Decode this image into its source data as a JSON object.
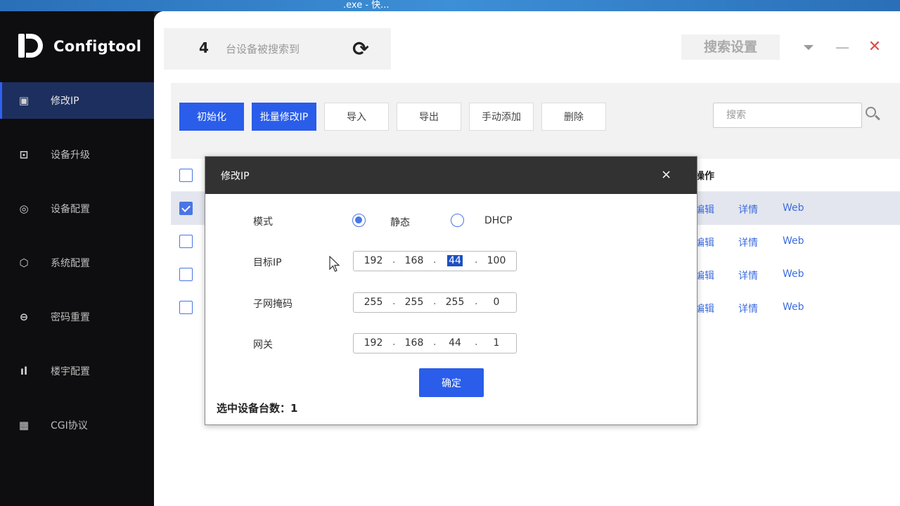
{
  "titlebar": {
    "text": ".exe - 快..."
  },
  "app": {
    "name": "Configtool"
  },
  "sidebar": {
    "items": [
      {
        "label": "修改IP",
        "icon": "ip-icon",
        "glyph": "▣"
      },
      {
        "label": "设备升级",
        "icon": "upgrade-icon",
        "glyph": "⊡"
      },
      {
        "label": "设备配置",
        "icon": "device-config-icon",
        "glyph": "◎"
      },
      {
        "label": "系统配置",
        "icon": "system-config-icon",
        "glyph": "⬡"
      },
      {
        "label": "密码重置",
        "icon": "password-reset-icon",
        "glyph": "⊖"
      },
      {
        "label": "楼宇配置",
        "icon": "building-config-icon",
        "glyph": "ıl"
      },
      {
        "label": "CGI协议",
        "icon": "cgi-icon",
        "glyph": "▦"
      }
    ]
  },
  "header": {
    "device_count": "4",
    "device_count_label": "台设备被搜索到",
    "search_settings": "搜索设置",
    "icons": {
      "refresh": "refresh-icon",
      "menu": "dropdown-icon",
      "minimize": "minimize-icon",
      "close": "close-icon"
    },
    "glyphs": {
      "refresh": "⟳",
      "menu": "⏷",
      "minimize": "—",
      "close": "✕"
    }
  },
  "toolbar": {
    "init": "初始化",
    "batch_modify": "批量修改IP",
    "import": "导入",
    "export": "导出",
    "manual_add": "手动添加",
    "delete": "删除",
    "search_placeholder": "搜索"
  },
  "table": {
    "ops_header": "操作",
    "rows": [
      {
        "checked": true,
        "edit": "编辑",
        "detail": "详情",
        "web": "Web"
      },
      {
        "checked": false,
        "edit": "编辑",
        "detail": "详情",
        "web": "Web"
      },
      {
        "checked": false,
        "edit": "编辑",
        "detail": "详情",
        "web": "Web"
      },
      {
        "checked": false,
        "edit": "编辑",
        "detail": "详情",
        "web": "Web"
      }
    ]
  },
  "modal": {
    "title": "修改IP",
    "close_glyph": "×",
    "mode_label": "模式",
    "static_label": "静态",
    "dhcp_label": "DHCP",
    "mode_selected": "静态",
    "target_ip_label": "目标IP",
    "target_ip": [
      "192",
      "168",
      "44",
      "100"
    ],
    "subnet_label": "子网掩码",
    "subnet": [
      "255",
      "255",
      "255",
      "0"
    ],
    "gateway_label": "网关",
    "gateway": [
      "192",
      "168",
      "44",
      "1"
    ],
    "confirm": "确定",
    "selected_count": "选中设备台数：1"
  },
  "colors": {
    "primary": "#2a5de9",
    "sidebar_bg": "#0e0e10",
    "active_nav": "#1d2f5e",
    "link": "#3d6ce0"
  }
}
